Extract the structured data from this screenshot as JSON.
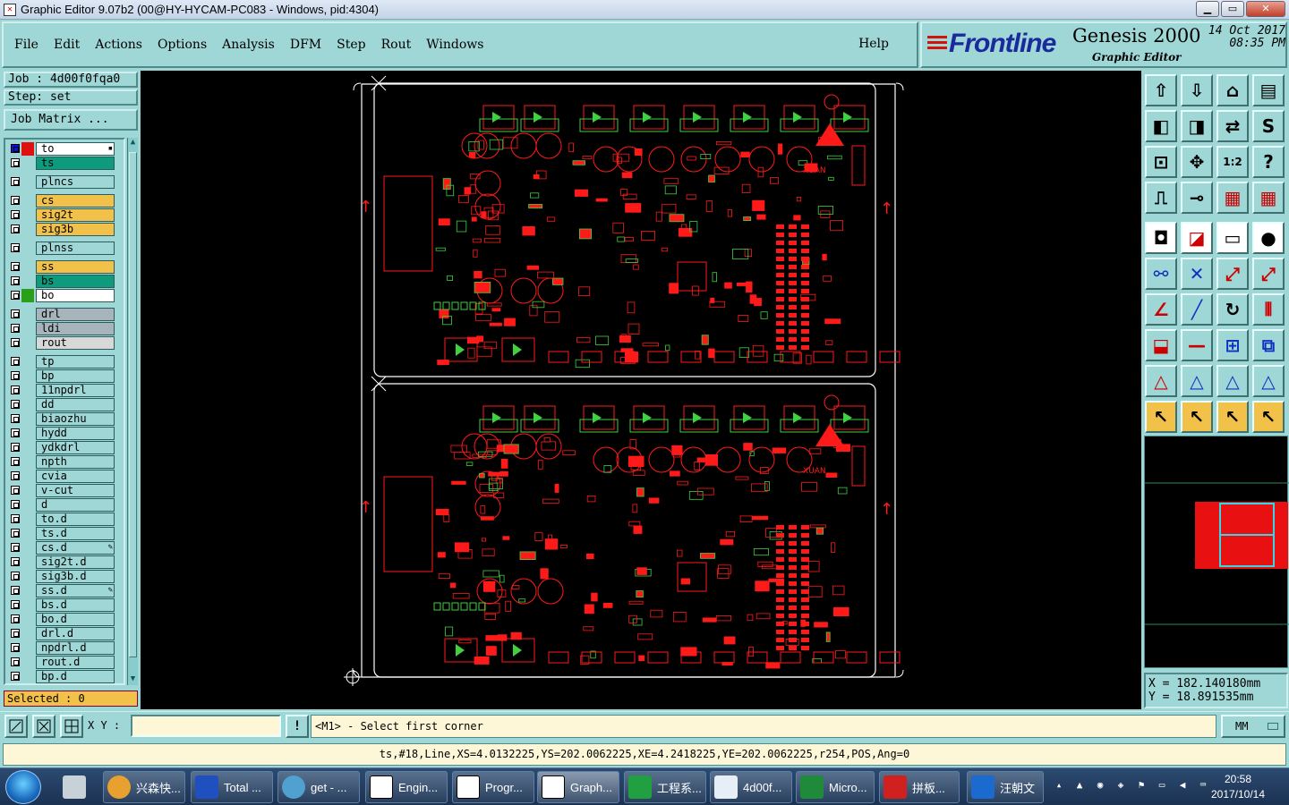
{
  "window": {
    "title": "Graphic Editor 9.07b2 (00@HY-HYCAM-PC083 - Windows, pid:4304)",
    "app_icon": "graphic-editor-icon",
    "controls": [
      "minimize",
      "maximize",
      "close"
    ]
  },
  "menu": {
    "items": [
      "File",
      "Edit",
      "Actions",
      "Options",
      "Analysis",
      "DFM",
      "Step",
      "Rout",
      "Windows"
    ],
    "help": "Help"
  },
  "brand": {
    "logo": "Frontline",
    "product": "Genesis 2000",
    "module": "Graphic Editor",
    "date": "14 Oct 2017",
    "time": "08:35 PM"
  },
  "job": {
    "job_label": "Job : 4d00f0fqa0",
    "step_label": "Step: set",
    "matrix_button": "Job Matrix ..."
  },
  "layers": [
    {
      "name": "to",
      "bg": "#ffffff",
      "swatch": "#1010d8",
      "swatch2": "#e01010",
      "mark": "▪"
    },
    {
      "name": "ts",
      "bg": "#0e9a7c",
      "swatch": "",
      "mark": ""
    },
    {
      "name": "plncs",
      "bg": "#9fd6d6",
      "swatch": "",
      "mark": ""
    },
    {
      "name": "cs",
      "bg": "#f2c14a",
      "swatch": "",
      "mark": ""
    },
    {
      "name": "sig2t",
      "bg": "#f2c14a",
      "swatch": "",
      "mark": ""
    },
    {
      "name": "sig3b",
      "bg": "#f2c14a",
      "swatch": "",
      "mark": ""
    },
    {
      "name": "plnss",
      "bg": "#9fd6d6",
      "swatch": "",
      "mark": ""
    },
    {
      "name": "ss",
      "bg": "#f2c14a",
      "swatch": "",
      "mark": ""
    },
    {
      "name": "bs",
      "bg": "#0e9a7c",
      "swatch": "",
      "mark": ""
    },
    {
      "name": "bo",
      "bg": "#ffffff",
      "swatch": "#2aa01a",
      "mark": ""
    },
    {
      "name": "drl",
      "bg": "#a8b4bc",
      "swatch": "",
      "mark": ""
    },
    {
      "name": "ldi",
      "bg": "#a8b4bc",
      "swatch": "",
      "mark": ""
    },
    {
      "name": "rout",
      "bg": "#d8d8d8",
      "swatch": "",
      "mark": ""
    },
    {
      "name": "tp",
      "bg": "#9fd6d6",
      "swatch": "",
      "mark": ""
    },
    {
      "name": "bp",
      "bg": "#9fd6d6",
      "swatch": "",
      "mark": ""
    },
    {
      "name": "11npdrl",
      "bg": "#9fd6d6",
      "swatch": "",
      "mark": ""
    },
    {
      "name": "dd",
      "bg": "#9fd6d6",
      "swatch": "",
      "mark": ""
    },
    {
      "name": "biaozhu",
      "bg": "#9fd6d6",
      "swatch": "",
      "mark": ""
    },
    {
      "name": "hydd",
      "bg": "#9fd6d6",
      "swatch": "",
      "mark": ""
    },
    {
      "name": "ydkdrl",
      "bg": "#9fd6d6",
      "swatch": "",
      "mark": ""
    },
    {
      "name": "npth",
      "bg": "#9fd6d6",
      "swatch": "",
      "mark": ""
    },
    {
      "name": "cvia",
      "bg": "#9fd6d6",
      "swatch": "",
      "mark": ""
    },
    {
      "name": "v-cut",
      "bg": "#9fd6d6",
      "swatch": "",
      "mark": ""
    },
    {
      "name": "d",
      "bg": "#9fd6d6",
      "swatch": "",
      "mark": ""
    },
    {
      "name": "to.d",
      "bg": "#9fd6d6",
      "swatch": "",
      "mark": ""
    },
    {
      "name": "ts.d",
      "bg": "#9fd6d6",
      "swatch": "",
      "mark": ""
    },
    {
      "name": "cs.d",
      "bg": "#9fd6d6",
      "swatch": "",
      "mark": "✎"
    },
    {
      "name": "sig2t.d",
      "bg": "#9fd6d6",
      "swatch": "",
      "mark": ""
    },
    {
      "name": "sig3b.d",
      "bg": "#9fd6d6",
      "swatch": "",
      "mark": ""
    },
    {
      "name": "ss.d",
      "bg": "#9fd6d6",
      "swatch": "",
      "mark": "✎"
    },
    {
      "name": "bs.d",
      "bg": "#9fd6d6",
      "swatch": "",
      "mark": ""
    },
    {
      "name": "bo.d",
      "bg": "#9fd6d6",
      "swatch": "",
      "mark": ""
    },
    {
      "name": "drl.d",
      "bg": "#9fd6d6",
      "swatch": "",
      "mark": ""
    },
    {
      "name": "npdrl.d",
      "bg": "#9fd6d6",
      "swatch": "",
      "mark": ""
    },
    {
      "name": "rout.d",
      "bg": "#9fd6d6",
      "swatch": "",
      "mark": ""
    },
    {
      "name": "bp.d",
      "bg": "#9fd6d6",
      "swatch": "",
      "mark": ""
    }
  ],
  "selected": "Selected : 0",
  "toolbar_icons": [
    "home-up-icon",
    "home-down-icon",
    "house-icon",
    "window-split-icon",
    "zoom-left-icon",
    "zoom-right-icon",
    "swap-icon",
    "s-shape-icon",
    "fit-screen-icon",
    "zoom-center-icon",
    "scale-1-2-icon",
    "help-query-icon",
    "measure-icon",
    "snap-icon",
    "layers-red-icon",
    "layers-red-alt-icon",
    "pad-icon",
    "line-edit-icon",
    "ruler-icon",
    "filled-circle-icon",
    "connect-icon",
    "cross-icon",
    "move-point-icon",
    "move-point-alt-icon",
    "angle-icon",
    "slope-icon",
    "rotate-icon",
    "mirror-icon",
    "transform-icon",
    "minus-icon",
    "resize-icon",
    "copy-blue-icon",
    "triangle-up-icon",
    "triangle-up2-icon",
    "triangle-arc-icon",
    "triangle-line-icon",
    "pointer-icon",
    "pointer-box-icon",
    "pointer-circle-icon",
    "pointer-poly-icon"
  ],
  "coords": {
    "x": "X = 182.140180mm",
    "y": "Y = 18.891535mm"
  },
  "command": {
    "xy_label": "X Y :",
    "xy_value": "",
    "message": "<M1> - Select first corner",
    "units": "MM"
  },
  "status_line": "ts,#18,Line,XS=4.0132225,YS=202.0062225,XE=4.2418225,YE=202.0062225,r254,POS,Ang=0",
  "canvas": {
    "panels": 2,
    "copper_color": "#ff1a1a",
    "silk_color": "#40d040",
    "outline_color": "#ffffff"
  },
  "taskbar": {
    "items": [
      "兴森快...",
      "Total ...",
      "get - ...",
      "Engin...",
      "Progr...",
      "Graph...",
      "工程系...",
      "4d00f...",
      "Micro...",
      "拼板...",
      "汪朝文"
    ],
    "time": "20:58",
    "date": "2017/10/14"
  }
}
